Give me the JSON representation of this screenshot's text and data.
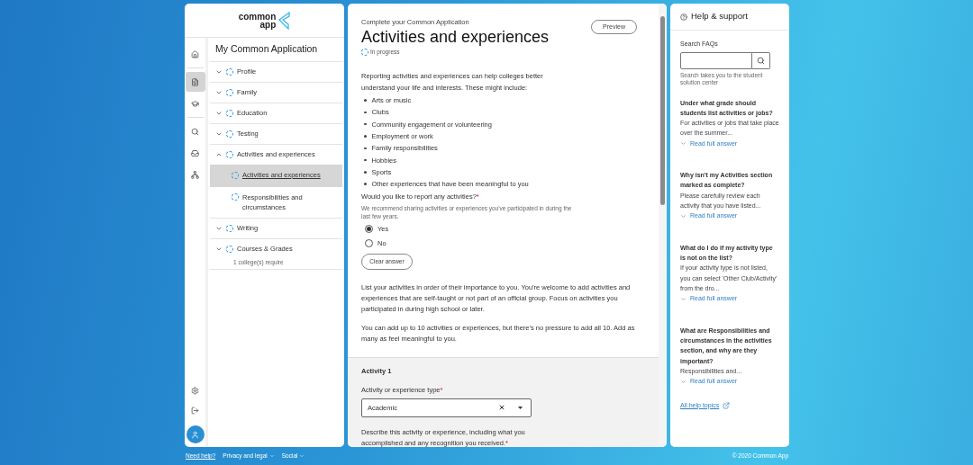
{
  "logo": {
    "line_1": "common",
    "line_2": "app"
  },
  "rail": [
    {
      "kind": "home",
      "selected": false
    },
    {
      "kind": "document",
      "selected": true
    },
    {
      "kind": "school",
      "selected": false
    },
    {
      "kind": "search",
      "selected": false
    },
    {
      "kind": "inbox",
      "selected": false
    },
    {
      "kind": "people",
      "selected": false
    }
  ],
  "rail_bottom": [
    {
      "kind": "settings"
    },
    {
      "kind": "logout"
    },
    {
      "kind": "profile"
    }
  ],
  "nav": {
    "title": "My Common Application",
    "items": [
      {
        "label": "Profile",
        "expanded": false
      },
      {
        "label": "Family",
        "expanded": false
      },
      {
        "label": "Education",
        "expanded": false
      },
      {
        "label": "Testing",
        "expanded": false
      },
      {
        "label": "Activities and experiences",
        "expanded": true,
        "children": [
          {
            "label": "Activities and experiences",
            "selected": true
          },
          {
            "label": "Responsibilities and circumstances",
            "selected": false
          }
        ]
      },
      {
        "label": "Writing",
        "expanded": false
      },
      {
        "label": "Courses & Grades",
        "expanded": false,
        "note": "1 college(s) require"
      }
    ]
  },
  "main": {
    "eyebrow": "Complete your Common Application",
    "title": "Activities and experiences",
    "status": "In progress",
    "preview_button": "Preview",
    "intro": "Reporting activities and experiences can help colleges better understand your life and interests. These might include:",
    "bullets": [
      "Arts or music",
      "Clubs",
      "Community engagement or volunteering",
      "Employment or work",
      "Family responsibilities",
      "Hobbies",
      "Sports",
      "Other experiences that have been meaningful to you"
    ],
    "question": {
      "label": "Would you like to report any activities?",
      "required_mark": "*",
      "hint": "We recommend sharing activities or experiences you've participated in during the last few years.",
      "options": [
        {
          "label": "Yes",
          "selected": true
        },
        {
          "label": "No",
          "selected": false
        }
      ]
    },
    "clear_button": "Clear answer",
    "paragraphs": [
      "List your activities in order of their importance to you. You're welcome to add activities and experiences that are self-taught or not part of an official group. Focus on activities you participated in during high school or later.",
      "You can add up to 10 activities or experiences, but there's no pressure to add all 10. Add as many as feel meaningful to you."
    ],
    "activity": {
      "title": "Activity 1",
      "type_label": "Activity or experience type",
      "type_required_mark": "*",
      "type_value": "Academic",
      "describe_label": "Describe this activity or experience, including what you accomplished and any recognition you received.",
      "describe_required_mark": "*"
    }
  },
  "help": {
    "title": "Help & support",
    "search_label": "Search FAQs",
    "search_hint": "Search takes you to the student solution center",
    "faqs": [
      {
        "question": "Under what grade should students list activities or jobs?",
        "excerpt": "For activities or jobs that take place over the summer...",
        "link": "Read full answer"
      },
      {
        "question": "Why isn't my Activities section marked as complete?",
        "excerpt": "Please carefully review each activity that you have listed...",
        "link": "Read full answer"
      },
      {
        "question": "What do I do if my activity type is not on the list?",
        "excerpt": "If your activity type is not listed, you can select 'Other Club/Activity' from the dro...",
        "link": "Read full answer"
      },
      {
        "question": "What are Responsibilities and circumstances in the activities section, and why are they important?",
        "excerpt": "Responsibilities and...",
        "link": "Read full answer"
      }
    ],
    "all_link": "All help topics"
  },
  "footer": {
    "links": [
      {
        "label": "Need help?",
        "kind": "link"
      },
      {
        "label": "Privacy and legal",
        "kind": "menu"
      },
      {
        "label": "Social",
        "kind": "menu"
      }
    ],
    "copyright": "© 2020 Common App"
  }
}
